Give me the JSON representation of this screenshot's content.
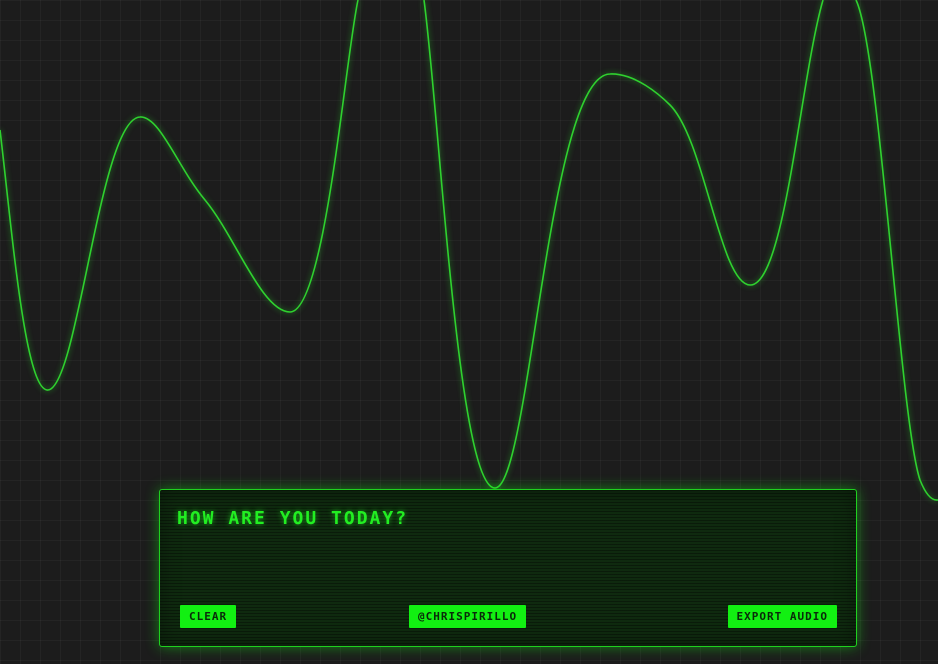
{
  "theme": {
    "background": "#1c1c1c",
    "wave_color": "#2fd12f",
    "accent": "#12f012",
    "panel_bg": "#0f2a0f"
  },
  "panel": {
    "prompt_text": "HOW ARE YOU TODAY?",
    "buttons": {
      "clear_label": "CLEAR",
      "handle_label": "@CHRISPIRILLO",
      "export_label": "EXPORT AUDIO"
    }
  }
}
